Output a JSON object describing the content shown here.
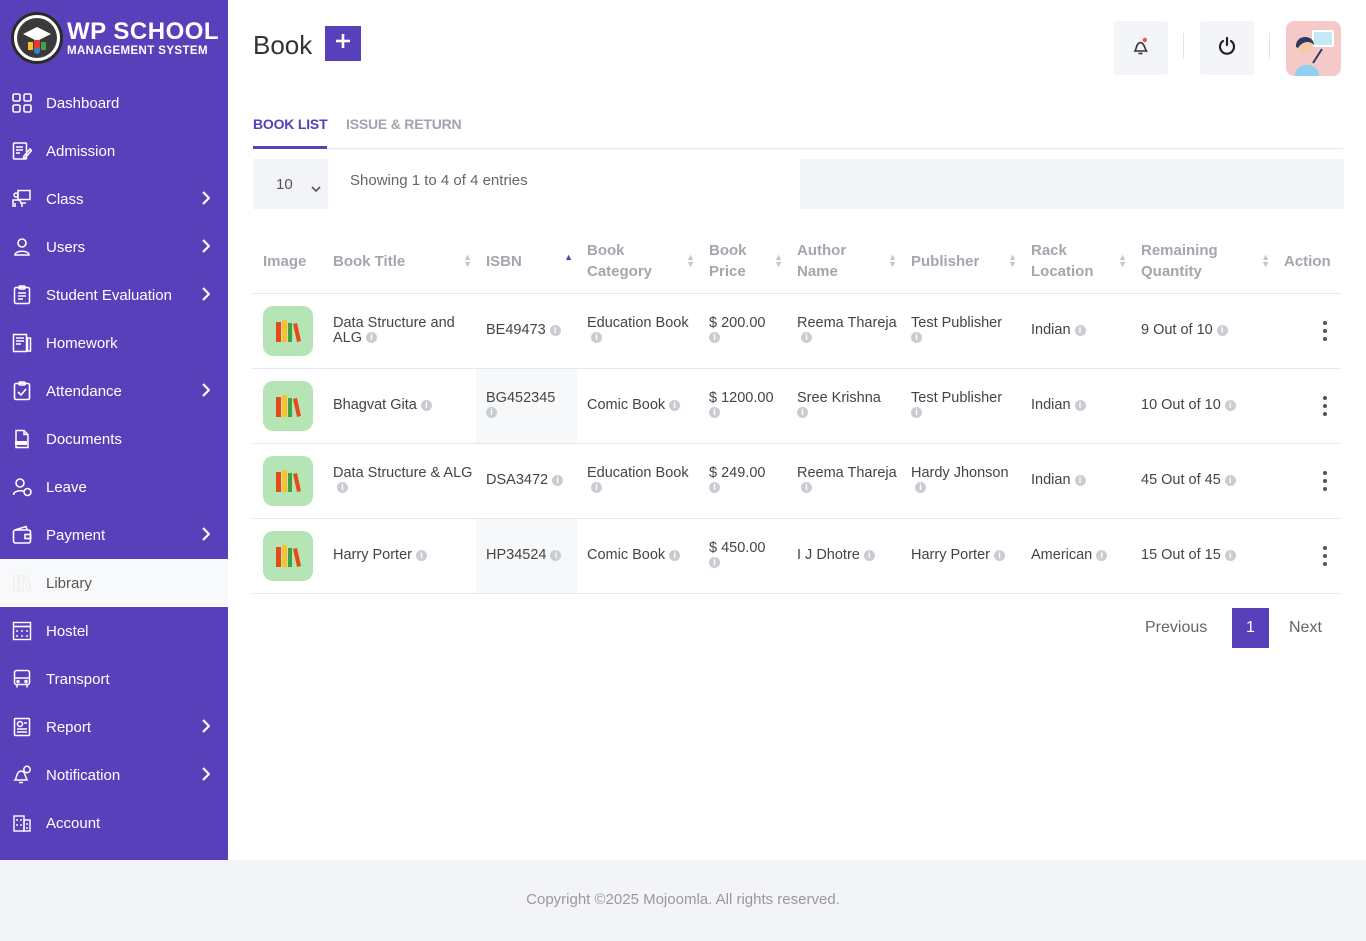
{
  "brand": {
    "title": "WP SCHOOL",
    "subtitle": "MANAGEMENT SYSTEM"
  },
  "sidebar": {
    "items": [
      {
        "label": "Dashboard",
        "has_submenu": false
      },
      {
        "label": "Admission",
        "has_submenu": false
      },
      {
        "label": "Class",
        "has_submenu": true
      },
      {
        "label": "Users",
        "has_submenu": true
      },
      {
        "label": "Student Evaluation",
        "has_submenu": true
      },
      {
        "label": "Homework",
        "has_submenu": false
      },
      {
        "label": "Attendance",
        "has_submenu": true
      },
      {
        "label": "Documents",
        "has_submenu": false
      },
      {
        "label": "Leave",
        "has_submenu": false
      },
      {
        "label": "Payment",
        "has_submenu": true
      },
      {
        "label": "Library",
        "has_submenu": false,
        "active": true
      },
      {
        "label": "Hostel",
        "has_submenu": false
      },
      {
        "label": "Transport",
        "has_submenu": false
      },
      {
        "label": "Report",
        "has_submenu": true
      },
      {
        "label": "Notification",
        "has_submenu": true
      },
      {
        "label": "Account",
        "has_submenu": false
      }
    ]
  },
  "header": {
    "title": "Book",
    "add_icon": "plus-icon",
    "notification_icon": "bell-icon",
    "logout_icon": "power-icon"
  },
  "tabs": [
    {
      "label": "BOOK LIST",
      "active": true
    },
    {
      "label": "ISSUE & RETURN",
      "active": false
    }
  ],
  "table_controls": {
    "page_length": "10",
    "showing_text": "Showing 1 to 4 of 4 entries"
  },
  "table": {
    "columns": [
      "Image",
      "Book Title",
      "ISBN",
      "Book Category",
      "Book Price",
      "Author Name",
      "Publisher",
      "Rack Location",
      "Remaining Quantity",
      "Action"
    ],
    "rows": [
      {
        "title": "Data Structure and ALG",
        "isbn": "BE49473",
        "category": "Education Book",
        "price": "$ 200.00",
        "author": "Reema Thareja",
        "publisher": "Test Publisher",
        "rack": "Indian",
        "remaining": "9 Out of 10"
      },
      {
        "title": "Bhagvat Gita",
        "isbn": "BG452345",
        "category": "Comic Book",
        "price": "$ 1200.00",
        "author": "Sree Krishna",
        "publisher": "Test Publisher",
        "rack": "Indian",
        "remaining": "10 Out of 10"
      },
      {
        "title": "Data Structure & ALG",
        "isbn": "DSA3472",
        "category": "Education Book",
        "price": "$ 249.00",
        "author": "Reema Thareja",
        "publisher": "Hardy Jhonson",
        "rack": "Indian",
        "remaining": "45 Out of 45"
      },
      {
        "title": "Harry Porter",
        "isbn": "HP34524",
        "category": "Comic Book",
        "price": "$ 450.00",
        "author": "I J Dhotre",
        "publisher": "Harry Porter",
        "rack": "American",
        "remaining": "15 Out of 15"
      }
    ]
  },
  "pagination": {
    "previous": "Previous",
    "current": "1",
    "next": "Next"
  },
  "footer": {
    "text": "Copyright ©2025 Mojoomla. All rights reserved."
  },
  "colors": {
    "accent": "#5840bb",
    "book_thumb_bg": "#b5e5b4",
    "avatar_bg": "#f6c9c9"
  }
}
